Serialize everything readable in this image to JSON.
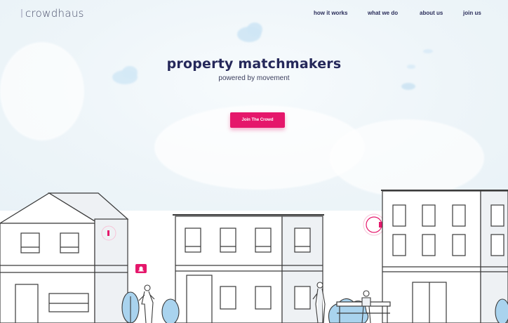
{
  "brand": {
    "logo": "crowdhaus"
  },
  "nav": {
    "items": [
      "how it works",
      "what we do",
      "about us",
      "join us"
    ]
  },
  "hero": {
    "title": "property matchmakers",
    "subtitle": "powered by movement",
    "cta_label": "Join The Crowd"
  },
  "colors": {
    "accent": "#e5176b",
    "navy": "#25285a",
    "line": "#3a3a3a",
    "sky": "#eef5f9",
    "tree": "#a9d3ee"
  }
}
